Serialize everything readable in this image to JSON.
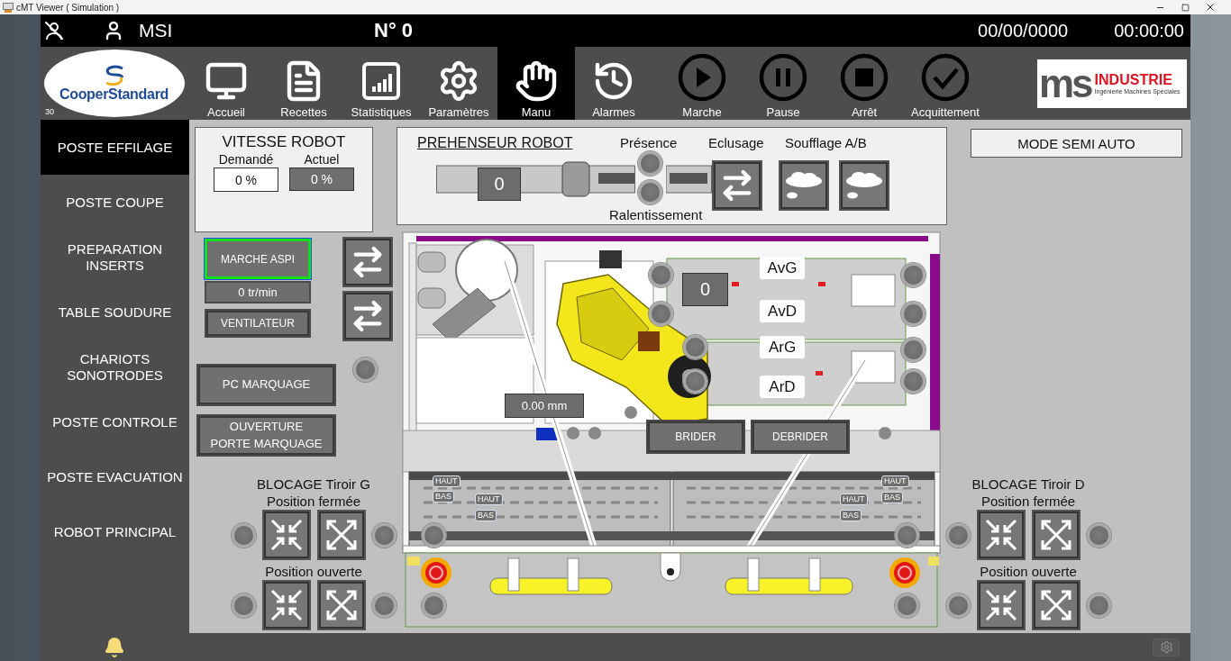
{
  "window": {
    "title": "cMT Viewer ( Simulation )"
  },
  "header": {
    "user": "MSI",
    "number": "N° 0",
    "date": "00/00/0000",
    "time": "00:00:00"
  },
  "logo": {
    "name": "CooperStandard",
    "station": "30"
  },
  "nav": [
    {
      "label": "Accueil",
      "kind": "monitor",
      "selected": false
    },
    {
      "label": "Recettes",
      "kind": "document",
      "selected": false
    },
    {
      "label": "Statistiques",
      "kind": "chart",
      "selected": false
    },
    {
      "label": "Paramètres",
      "kind": "gear",
      "selected": false
    },
    {
      "label": "Manu",
      "kind": "hand",
      "selected": true
    },
    {
      "label": "Alarmes",
      "kind": "history",
      "selected": false
    }
  ],
  "actions": [
    {
      "label": "Marche",
      "kind": "play"
    },
    {
      "label": "Pause",
      "kind": "pause"
    },
    {
      "label": "Arrêt",
      "kind": "stop"
    },
    {
      "label": "Acquittement",
      "kind": "check"
    }
  ],
  "brand": {
    "mark": "ms",
    "name": "INDUSTRIE",
    "tagline": "Ingénierie Machines Spéciales"
  },
  "sidebar": {
    "items": [
      {
        "label": "POSTE EFFILAGE",
        "selected": true
      },
      {
        "label": "POSTE COUPE",
        "selected": false
      },
      {
        "label": "PREPARATION\nINSERTS",
        "selected": false
      },
      {
        "label": "TABLE SOUDURE",
        "selected": false
      },
      {
        "label": "CHARIOTS\nSONOTRODES",
        "selected": false
      },
      {
        "label": "POSTE CONTROLE",
        "selected": false
      },
      {
        "label": "POSTE EVACUATION",
        "selected": false
      },
      {
        "label": "ROBOT PRINCIPAL",
        "selected": false
      }
    ]
  },
  "robot_speed": {
    "title": "VITESSE ROBOT",
    "requested_label": "Demandé",
    "requested": "0 %",
    "actual_label": "Actuel",
    "actual": "0 %"
  },
  "aspiration": {
    "button": "MARCHE ASPI",
    "active": true,
    "speed": "0 tr/min",
    "fan": "VENTILATEUR"
  },
  "marking": {
    "pc": "PC MARQUAGE",
    "door": "OUVERTURE\nPORTE MARQUAGE"
  },
  "gripper": {
    "title": "PREHENSEUR ROBOT",
    "counter": "0",
    "presence": "Présence",
    "slowdown": "Ralentissement",
    "lock": "Eclusage",
    "blow": "Soufflage A/B"
  },
  "machine": {
    "counter": "0",
    "offset": "0.00 mm",
    "clamp": "BRIDER",
    "unclamp": "DEBRIDER",
    "positions": [
      "AvG",
      "AvD",
      "ArG",
      "ArD"
    ],
    "tags": [
      "HAUT",
      "BAS",
      "HAUT",
      "BAS",
      "HAUT",
      "HAUT",
      "BAS",
      "BAS"
    ]
  },
  "mode": "MODE SEMI AUTO",
  "drawer_locks": [
    {
      "title": "BLOCAGE Tiroir G",
      "closed": "Position fermée",
      "open": "Position ouverte"
    },
    {
      "title": "BLOCAGE Tiroir D",
      "closed": "Position fermée",
      "open": "Position ouverte"
    }
  ]
}
